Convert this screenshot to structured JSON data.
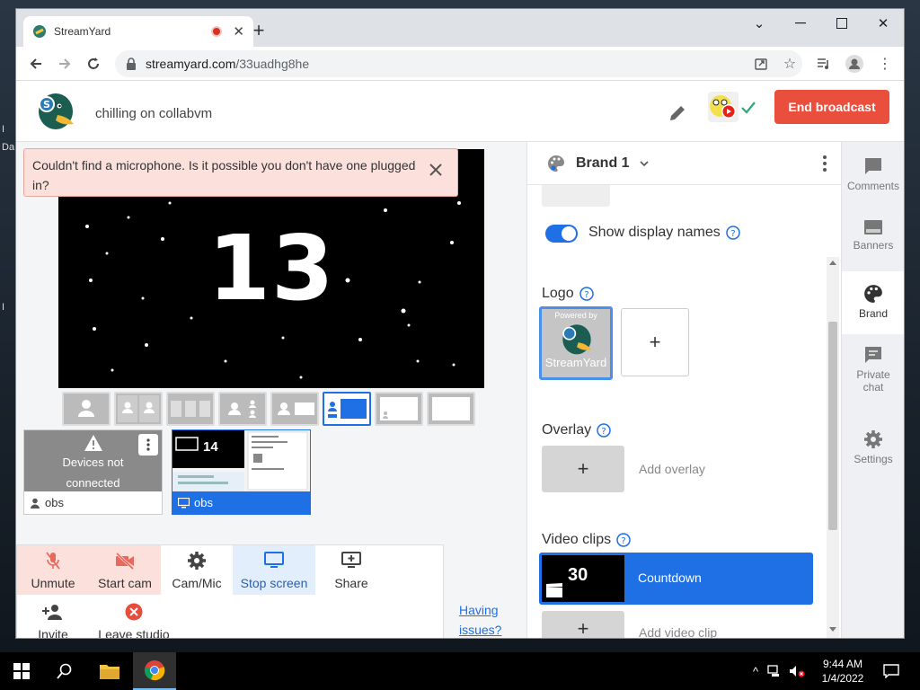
{
  "desktop": {
    "fragments": [
      "Da",
      "I",
      "I"
    ]
  },
  "browser": {
    "tab_title": "StreamYard",
    "url_host": "streamyard.com",
    "url_path": "/33uadhg8he"
  },
  "header": {
    "stream_title": "chilling on collabvm",
    "end_button": "End broadcast"
  },
  "stage": {
    "countdown_value": "13",
    "alert_text": "Couldn't find a microphone. Is it possible you don't have one plugged in?"
  },
  "participants": [
    {
      "status": "Devices not connected",
      "name": "obs",
      "icon": "person-icon"
    },
    {
      "preview_number": "14",
      "name": "obs",
      "icon": "monitor-icon"
    }
  ],
  "controls": {
    "unmute": "Unmute",
    "start_cam": "Start cam",
    "cam_mic": "Cam/Mic",
    "stop_screen": "Stop screen",
    "share": "Share",
    "invite": "Invite",
    "leave": "Leave studio",
    "having_issues": "Having issues?"
  },
  "brand_panel": {
    "brand_name": "Brand 1",
    "show_names_label": "Show display names",
    "show_names_enabled": true,
    "logo_label": "Logo",
    "logo_powered_by": "Powered by",
    "logo_text": "StreamYard",
    "overlay_label": "Overlay",
    "add_overlay": "Add overlay",
    "video_clips_label": "Video clips",
    "clip_name": "Countdown",
    "clip_thumb_number": "30",
    "add_video_clip": "Add video clip"
  },
  "rail": {
    "comments": "Comments",
    "banners": "Banners",
    "brand": "Brand",
    "private_chat": "Private chat",
    "settings": "Settings"
  },
  "taskbar": {
    "time": "9:44 AM",
    "date": "1/4/2022"
  },
  "colors": {
    "accent": "#1f6fe5",
    "danger": "#ea4e3d",
    "alert_bg": "#fbe0dc"
  }
}
